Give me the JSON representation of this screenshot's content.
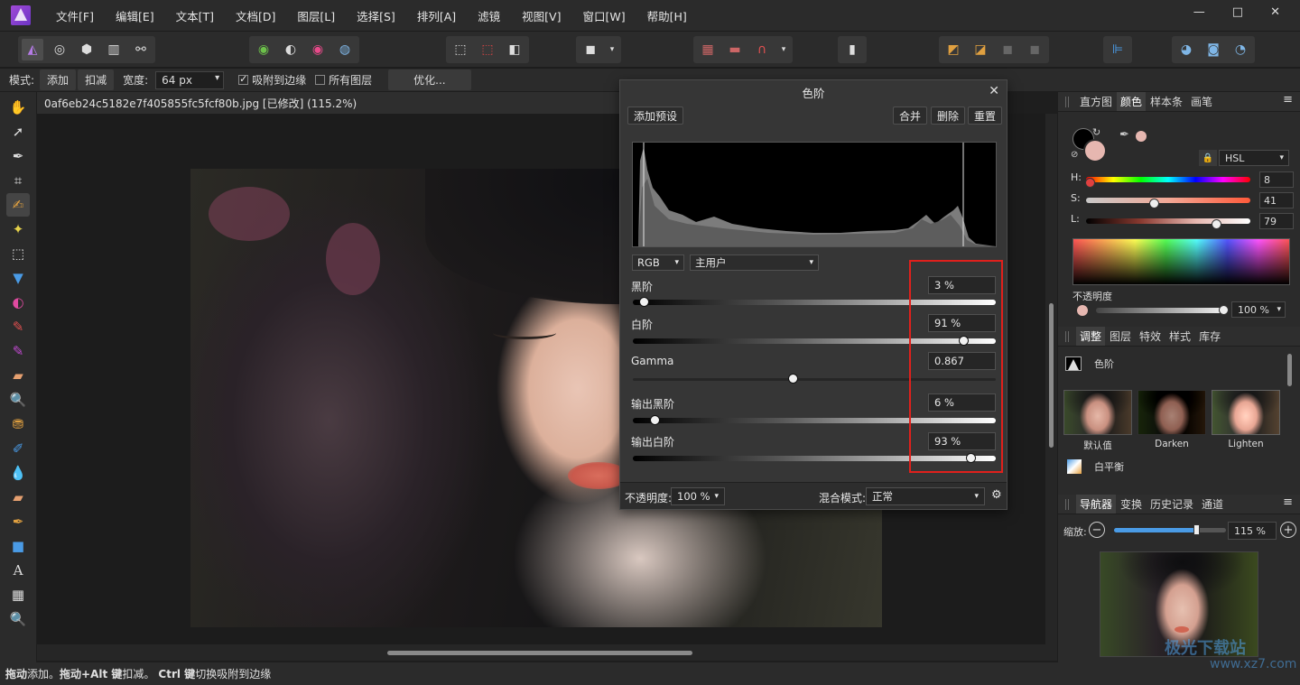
{
  "menu": [
    "文件[F]",
    "编辑[E]",
    "文本[T]",
    "文档[D]",
    "图层[L]",
    "选择[S]",
    "排列[A]",
    "滤镜",
    "视图[V]",
    "窗口[W]",
    "帮助[H]"
  ],
  "window_controls": {
    "minimize": "—",
    "maximize": "□",
    "close": "✕"
  },
  "context_bar": {
    "mode_label": "模式:",
    "add": "添加",
    "subtract": "扣减",
    "width_label": "宽度:",
    "width_value": "64 px",
    "snap_label": "吸附到边缘",
    "all_layers_label": "所有图层",
    "refine": "优化..."
  },
  "document": {
    "tab_title": "0af6eb24c5182e7f405855fc5fcf80b.jpg [已修改] (115.2%)"
  },
  "status_bar": {
    "drag": "拖动",
    "t1": " 添加。",
    "drag_alt": "拖动+Alt 键",
    "t2": " 扣减。",
    "ctrl": "Ctrl 键",
    "t3": " 切换吸附到边缘"
  },
  "levels": {
    "title": "色阶",
    "add_preset": "添加预设",
    "merge": "合并",
    "delete": "删除",
    "reset": "重置",
    "channel": "RGB",
    "preset": "主用户",
    "black_label": "黑阶",
    "black_value": "3 %",
    "black_level": 0.03,
    "white_label": "白阶",
    "white_value": "91 %",
    "white_level": 0.91,
    "gamma_label": "Gamma",
    "gamma_value": "0.867",
    "gamma_position": 0.44,
    "out_black_label": "输出黑阶",
    "out_black_value": "6 %",
    "out_black_level": 0.06,
    "out_white_label": "输出白阶",
    "out_white_value": "93 %",
    "out_white_level": 0.93,
    "opacity_label": "不透明度:",
    "opacity_value": "100 %",
    "blend_label": "混合模式:",
    "blend_value": "正常"
  },
  "color_panel": {
    "tabs": [
      "直方图",
      "颜色",
      "样本条",
      "画笔"
    ],
    "active_tab": "颜色",
    "model": "HSL",
    "h_label": "H:",
    "h_value": "8",
    "s_label": "S:",
    "s_value": "41",
    "l_label": "L:",
    "l_value": "79",
    "opacity_label": "不透明度",
    "opacity_value": "100 %",
    "swatch_color": "#e6b7b0"
  },
  "adjust_panel": {
    "tabs": [
      "调整",
      "图层",
      "特效",
      "样式",
      "库存"
    ],
    "active_tab": "调整",
    "levels_item": "色阶",
    "presets": [
      "默认值",
      "Darken",
      "Lighten"
    ],
    "white_balance": "白平衡"
  },
  "navigator_panel": {
    "tabs": [
      "导航器",
      "变换",
      "历史记录",
      "通道"
    ],
    "active_tab": "导航器",
    "zoom_label": "缩放:",
    "zoom_value": "115 %"
  },
  "watermark": {
    "line1": "极光下载站",
    "line2": "www.xz7.com"
  }
}
